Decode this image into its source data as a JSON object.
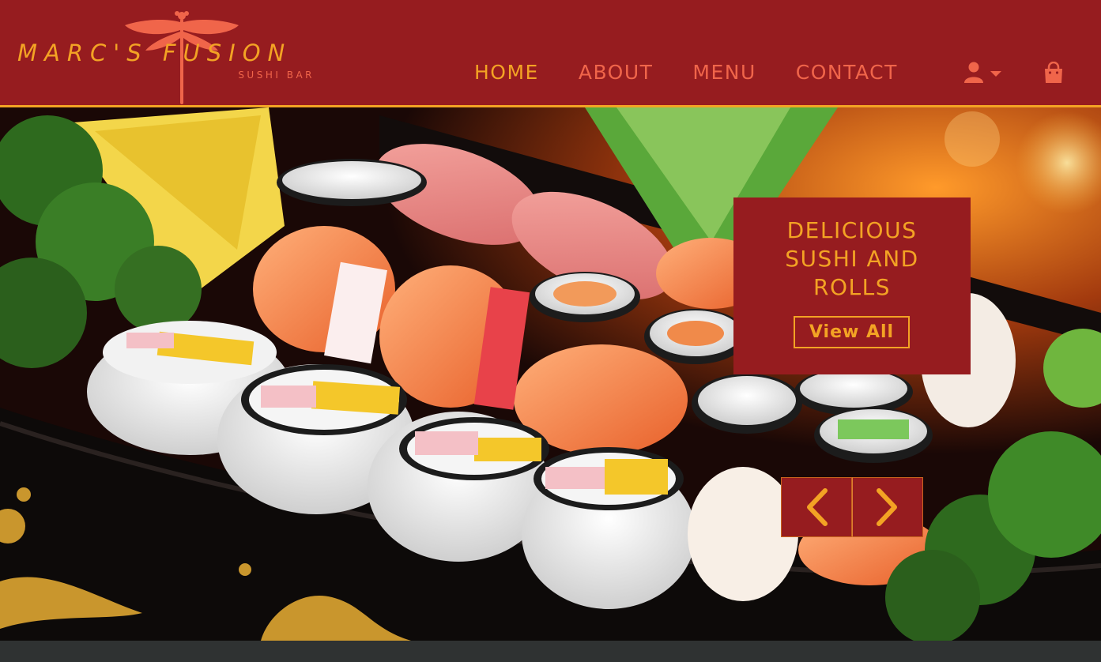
{
  "brand": {
    "name": "MARC'S FUSION",
    "tagline": "SUSHI BAR"
  },
  "nav": {
    "items": [
      {
        "label": "HOME",
        "active": true
      },
      {
        "label": "ABOUT",
        "active": false
      },
      {
        "label": "MENU",
        "active": false
      },
      {
        "label": "CONTACT",
        "active": false
      }
    ],
    "user_icon": "user-icon",
    "dropdown_icon": "caret-down-icon",
    "cart_icon": "shopping-bag-icon"
  },
  "hero": {
    "image_subject": "sushi boat platter",
    "promo": {
      "title": "DELICIOUS\nSUSHI AND\nROLLS",
      "button_label": "View All"
    },
    "prev_icon": "chevron-left-icon",
    "next_icon": "chevron-right-icon"
  },
  "colors": {
    "brand_red": "#961c1f",
    "accent_gold": "#f3a324",
    "nav_coral": "#f0654a",
    "footer": "#2f3232"
  }
}
